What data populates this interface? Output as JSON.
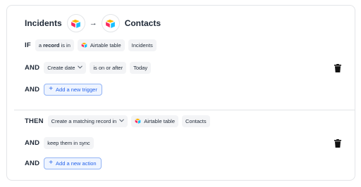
{
  "header": {
    "source": "Incidents",
    "arrow": "→",
    "destination": "Contacts"
  },
  "trigger": {
    "if_row": {
      "keyword": "IF",
      "chip_prefix": "a",
      "chip_bold": "record",
      "chip_suffix": "is in",
      "app_label": "Airtable table",
      "table": "Incidents"
    },
    "and_row": {
      "keyword": "AND",
      "field": "Create date",
      "operator": "is on or after",
      "value": "Today"
    },
    "add_row": {
      "keyword": "AND",
      "button_label": "Add a new trigger"
    }
  },
  "action": {
    "then_row": {
      "keyword": "THEN",
      "action": "Create a matching record in",
      "app_label": "Airtable table",
      "table": "Contacts"
    },
    "sync_row": {
      "keyword": "AND",
      "label": "keep them in sync"
    },
    "add_row": {
      "keyword": "AND",
      "button_label": "Add a new action"
    }
  },
  "icons": {
    "app_logo": "airtable-logo-icon",
    "delete": "trash-icon",
    "dropdown": "chevron-down-icon",
    "add": "plus-icon"
  },
  "colors": {
    "airtable_yellow": "#fcb400",
    "airtable_blue": "#18bfff",
    "airtable_red": "#f82b60",
    "accent_blue": "#2563eb",
    "chip_bg": "#f3f4f6"
  }
}
